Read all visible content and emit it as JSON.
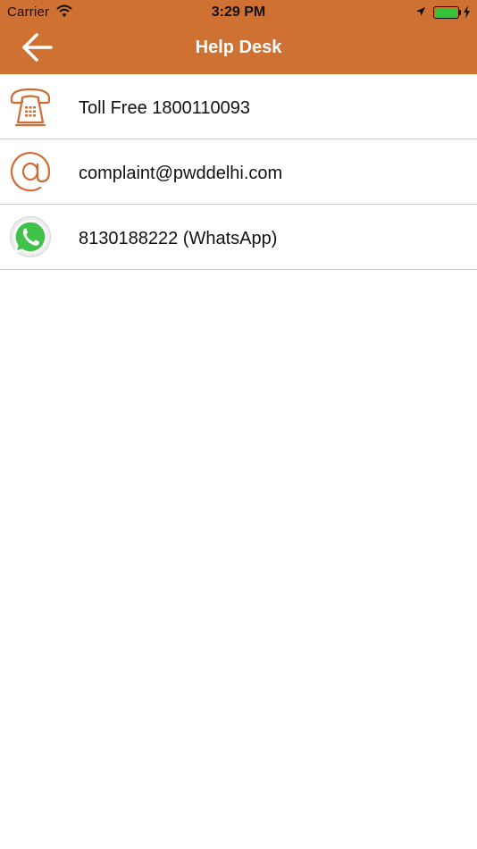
{
  "status_bar": {
    "carrier": "Carrier",
    "time": "3:29 PM",
    "battery_level": 1.0
  },
  "nav": {
    "title": "Help Desk",
    "back_icon": "arrow-left-icon"
  },
  "colors": {
    "nav_background": "#cf7133",
    "icon_accent": "#cf6b35",
    "whatsapp_green": "#3fc14a",
    "battery_green": "#35c339",
    "divider": "#c8c7cc"
  },
  "contacts": [
    {
      "icon": "telephone-icon",
      "label": "Toll Free 1800110093"
    },
    {
      "icon": "at-sign-icon",
      "label": "complaint@pwddelhi.com"
    },
    {
      "icon": "whatsapp-icon",
      "label": "8130188222 (WhatsApp)"
    }
  ]
}
